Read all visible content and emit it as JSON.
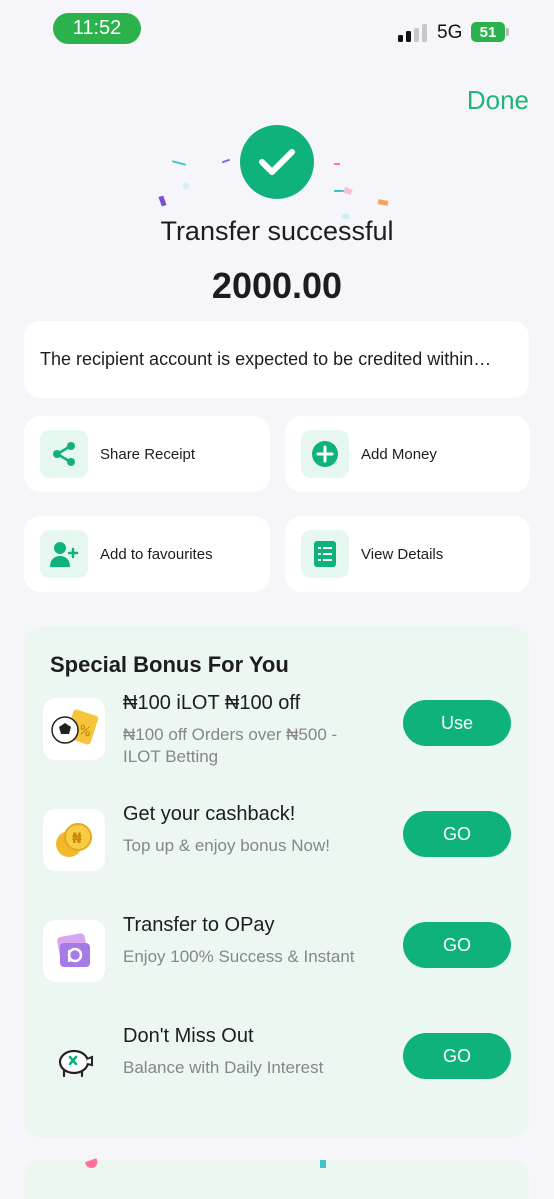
{
  "status_bar": {
    "time": "11:52",
    "network": "5G",
    "battery": "51"
  },
  "header": {
    "done_label": "Done"
  },
  "result": {
    "title": "Transfer successful",
    "amount": "2000.00",
    "icon": "check-icon"
  },
  "notice": {
    "text": "The recipient account is expected to be credited within…"
  },
  "actions": [
    {
      "label": "Share Receipt",
      "icon": "share-icon"
    },
    {
      "label": "Add Money",
      "icon": "plus-circle-icon"
    },
    {
      "label": "Add to favourites",
      "icon": "add-user-icon"
    },
    {
      "label": "View Details",
      "icon": "list-document-icon"
    }
  ],
  "bonus": {
    "title": "Special Bonus For You",
    "offers": [
      {
        "title": "₦100 iLOT ₦100 off",
        "subtitle": "₦100 off Orders over ₦500 - ILOT Betting",
        "button": "Use",
        "icon": "soccer-ticket-icon"
      },
      {
        "title": "Get your cashback!",
        "subtitle": "Top up & enjoy bonus Now!",
        "button": "GO",
        "icon": "coins-icon"
      },
      {
        "title": "Transfer to OPay",
        "subtitle": "Enjoy 100% Success & Instant",
        "button": "GO",
        "icon": "opay-wallet-icon"
      },
      {
        "title": "Don't Miss Out",
        "subtitle": "Balance with Daily Interest",
        "button": "GO",
        "icon": "piggy-bank-icon"
      }
    ]
  },
  "colors": {
    "accent": "#0fb27a",
    "done": "#1fb578",
    "bonus_bg": "#ebf7f0",
    "icon_bg": "#e6f7ef"
  }
}
